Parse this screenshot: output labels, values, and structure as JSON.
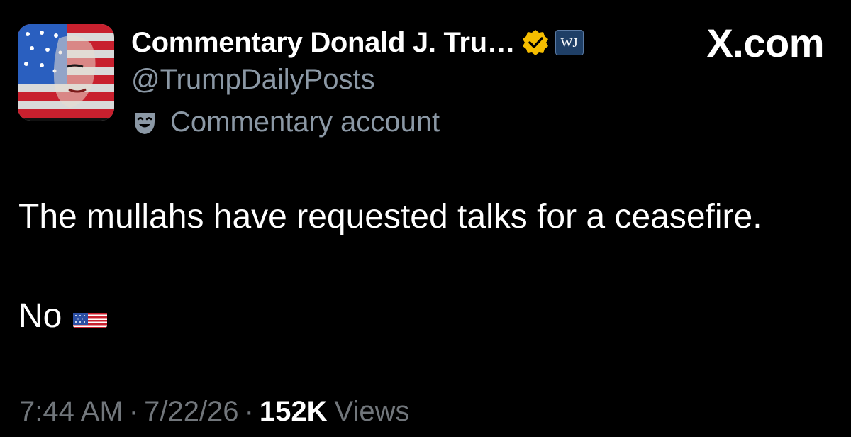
{
  "brand": {
    "label": "X.com"
  },
  "author": {
    "display_name": "Commentary Donald J. Tru…",
    "handle": "@TrumpDailyPosts",
    "affiliation_badge": "WJ",
    "verified_badge_color": "#f5bd00",
    "commentary_label": "Commentary account",
    "avatar_icon": "flag-portrait-avatar"
  },
  "post": {
    "text_line_1": "The mullahs have requested talks for a ceasefire.",
    "text_line_2": "No",
    "emoji_icon": "us-flag-icon"
  },
  "meta": {
    "time": "7:44 AM",
    "separator": "·",
    "date": "7/22/26",
    "views_count": "152K",
    "views_label": "Views"
  },
  "colors": {
    "background": "#000000",
    "primary_text": "#ffffff",
    "secondary_text": "#8b98a5",
    "meta_text": "#71767b"
  }
}
